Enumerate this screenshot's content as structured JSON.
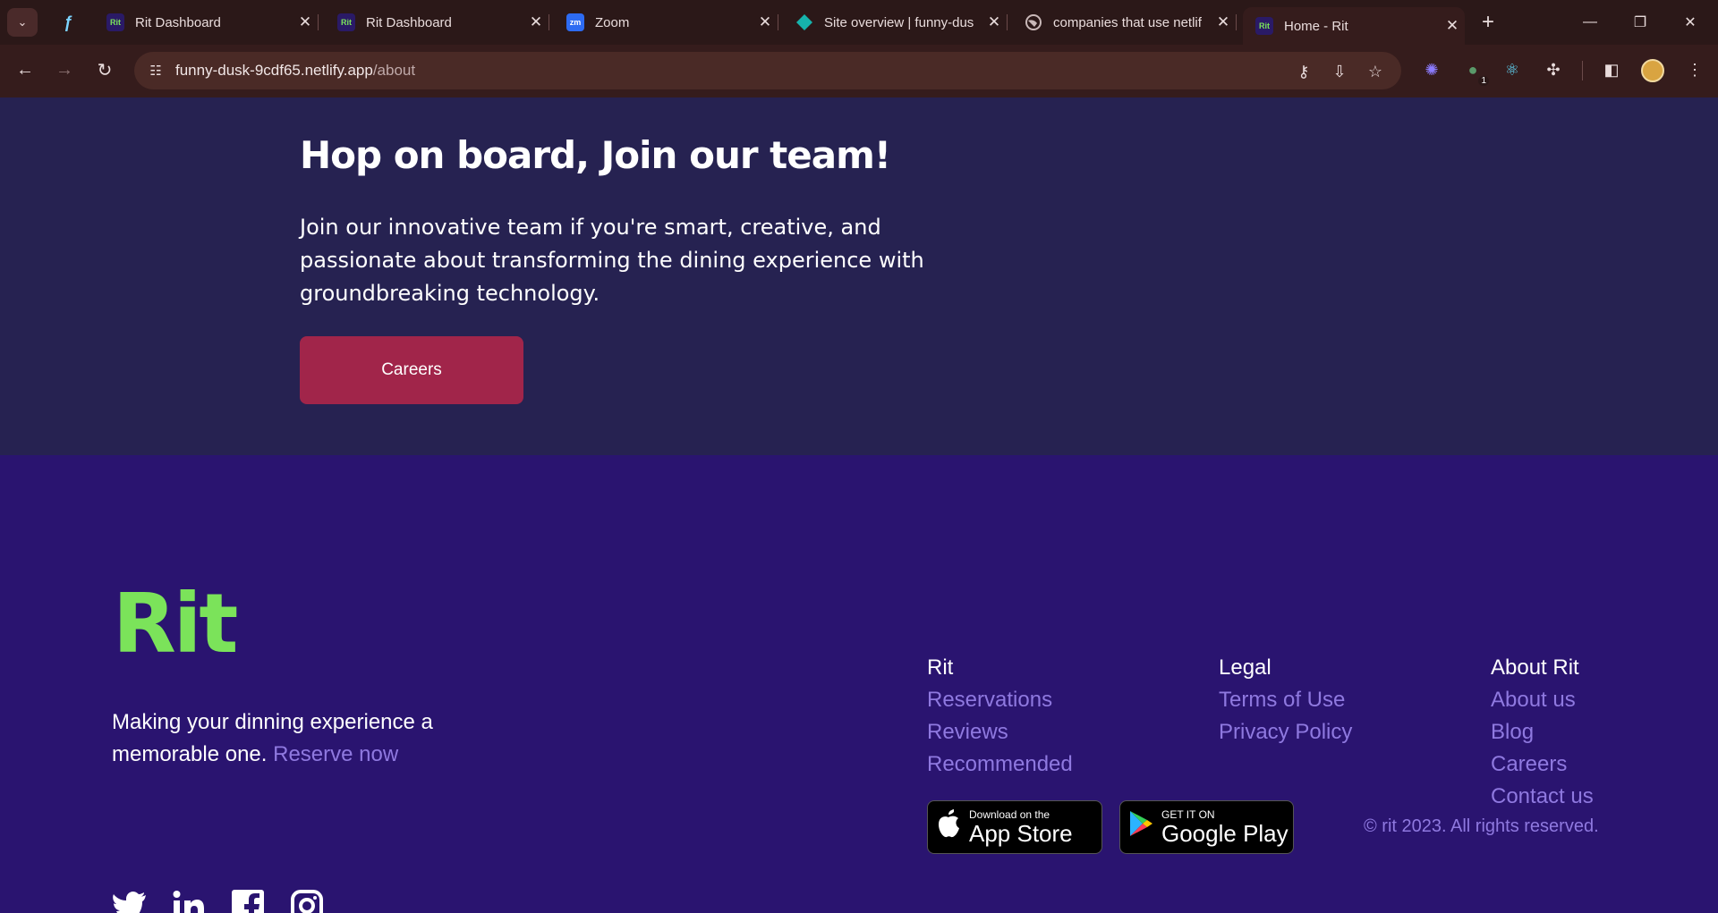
{
  "browser": {
    "tabs": [
      {
        "title": "Rit Dashboard",
        "favicon": "rit-favicon"
      },
      {
        "title": "Rit Dashboard",
        "favicon": "rit-favicon"
      },
      {
        "title": "Zoom",
        "favicon": "zoom-favicon"
      },
      {
        "title": "Site overview | funny-dus",
        "favicon": "netlify-favicon"
      },
      {
        "title": "companies that use netlif",
        "favicon": "globe-favicon"
      },
      {
        "title": "Home - Rit",
        "favicon": "rit-favicon",
        "active": true
      }
    ],
    "favicon_text": {
      "rit": "Rit",
      "zoom": "zm"
    },
    "url": {
      "host": "funny-dusk-9cdf65.netlify.app",
      "path": "/about"
    },
    "extension_badge": "1"
  },
  "hero": {
    "title": "Hop on board, Join our team!",
    "body": "Join our innovative team if you're smart, creative, and passionate about transforming the dining experience with groundbreaking technology.",
    "cta_label": "Careers"
  },
  "footer": {
    "logo_text": "Rit",
    "tagline": "Making your dinning experience a memorable one.",
    "tagline_link": "Reserve now",
    "columns": [
      {
        "heading": "Rit",
        "links": [
          "Reservations",
          "Reviews",
          "Recommended"
        ]
      },
      {
        "heading": "Legal",
        "links": [
          "Terms of Use",
          "Privacy Policy"
        ]
      },
      {
        "heading": "About Rit",
        "links": [
          "About us",
          "Blog",
          "Careers",
          "Contact us"
        ]
      }
    ],
    "app_store": {
      "small": "Download on the",
      "big": "App Store"
    },
    "google_play": {
      "small": "GET IT ON",
      "big": "Google Play"
    },
    "copyright": "© rit 2023. All rights reserved.",
    "social": [
      "twitter-icon",
      "linkedin-icon",
      "facebook-icon",
      "instagram-icon"
    ]
  },
  "colors": {
    "hero_bg": "#262251",
    "footer_bg": "#2a1470",
    "accent": "#a1254a",
    "logo": "#7be35a",
    "link": "#8f79e0"
  }
}
